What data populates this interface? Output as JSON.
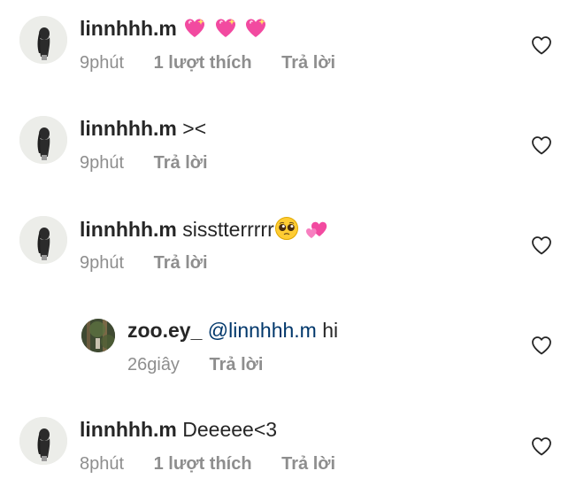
{
  "comments": [
    {
      "username": "linnhhh.m",
      "text": "",
      "emoji": [
        "sparkling-heart",
        "sparkling-heart",
        "sparkling-heart"
      ],
      "time": "9phút",
      "likes": "1 lượt thích",
      "reply_label": "Trả lời"
    },
    {
      "username": "linnhhh.m",
      "text": "><",
      "time": "9phút",
      "reply_label": "Trả lời"
    },
    {
      "username": "linnhhh.m",
      "text": "sisstterrrrr",
      "emoji": [
        "pleading-face",
        "revolving-hearts"
      ],
      "time": "9phút",
      "reply_label": "Trả lời"
    },
    {
      "username": "zoo.ey_",
      "mention": "@linnhhh.m",
      "text": "hi",
      "time": "26giây",
      "reply_label": "Trả lời"
    },
    {
      "username": "linnhhh.m",
      "text": "Deeeee<3",
      "time": "8phút",
      "likes": "1 lượt thích",
      "reply_label": "Trả lời"
    }
  ],
  "icons": {
    "like": "heart-outline-icon",
    "avatar_main": "silhouette-avatar",
    "avatar_reply": "forest-avatar"
  },
  "colors": {
    "text": "#262626",
    "secondary": "#8e8e8e",
    "mention": "#00376b",
    "emoji_heart": "#f24aa0"
  }
}
